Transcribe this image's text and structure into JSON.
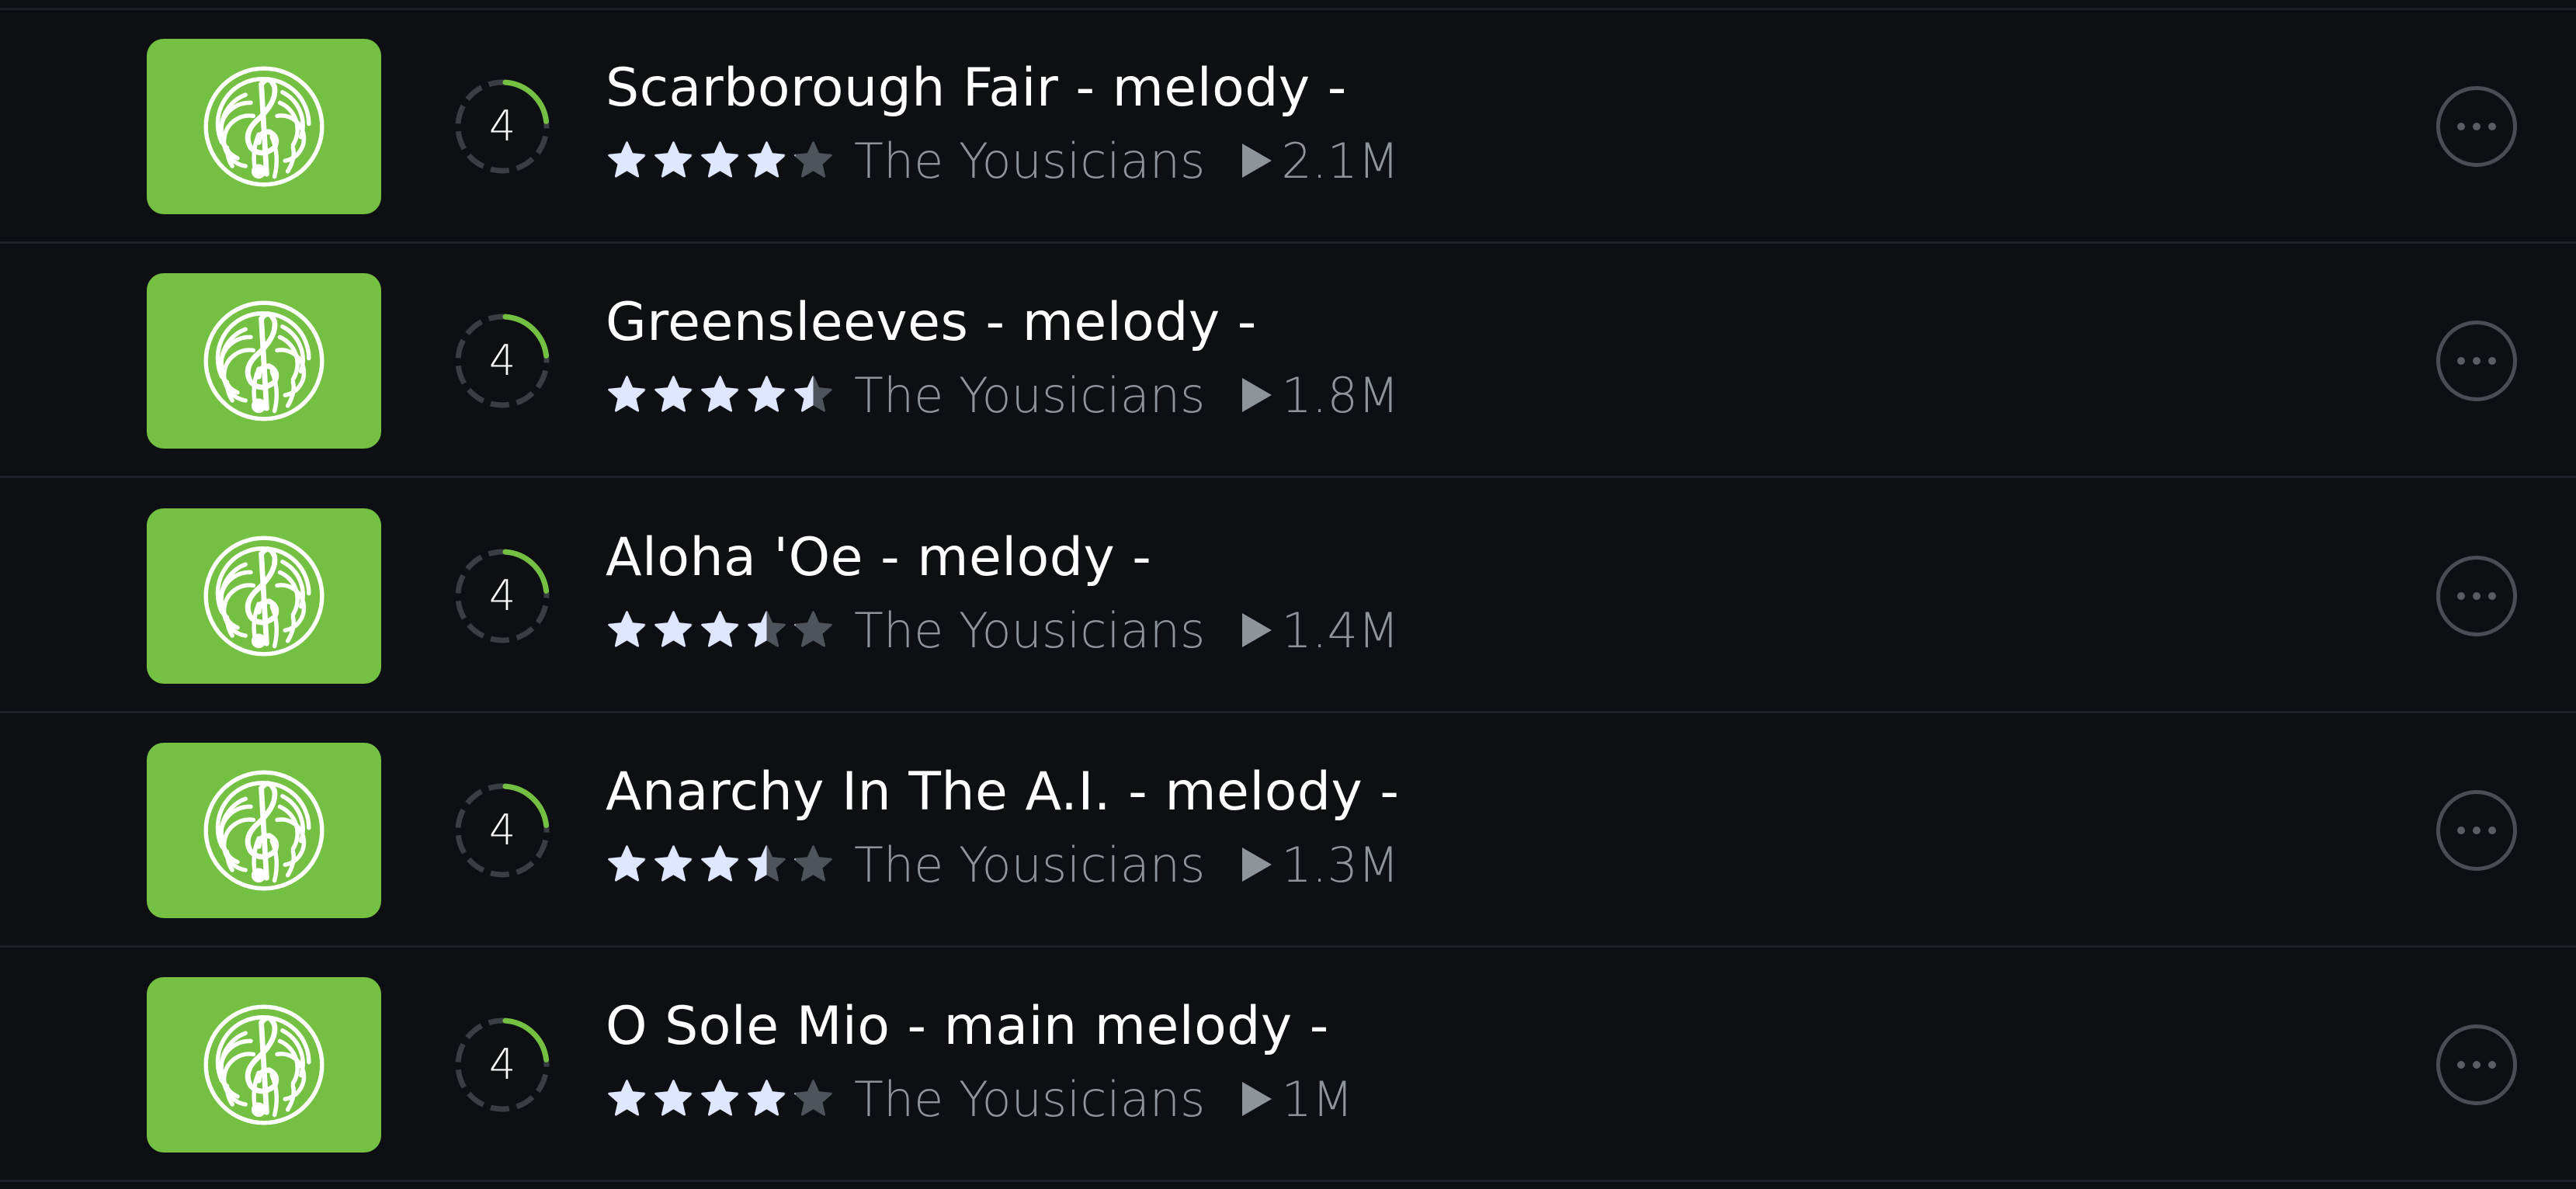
{
  "colors": {
    "background": "#0d0f12",
    "thumb_green": "#74c043",
    "ring_green": "#74c043",
    "ring_track": "#3a3d42",
    "star_filled": "#dfe6ff",
    "star_empty": "#4f535b",
    "secondary_text": "#8f939a"
  },
  "songs": [
    {
      "title": "Scarborough Fair - melody -",
      "level": "4",
      "rating": 4,
      "artist": "The Yousicians",
      "plays": "2.1M",
      "thumb_icon": "yousician-fingerprint-clef-icon"
    },
    {
      "title": "Greensleeves - melody -",
      "level": "4",
      "rating": 4.5,
      "artist": "The Yousicians",
      "plays": "1.8M",
      "thumb_icon": "yousician-fingerprint-clef-icon"
    },
    {
      "title": "Aloha 'Oe - melody -",
      "level": "4",
      "rating": 3.5,
      "artist": "The Yousicians",
      "plays": "1.4M",
      "thumb_icon": "yousician-fingerprint-clef-icon"
    },
    {
      "title": "Anarchy In The A.I. - melody -",
      "level": "4",
      "rating": 3.5,
      "artist": "The Yousicians",
      "plays": "1.3M",
      "thumb_icon": "yousician-fingerprint-clef-icon"
    },
    {
      "title": "O Sole Mio - main melody -",
      "level": "4",
      "rating": 4,
      "artist": "The Yousicians",
      "plays": "1M",
      "thumb_icon": "yousician-fingerprint-clef-icon"
    }
  ]
}
